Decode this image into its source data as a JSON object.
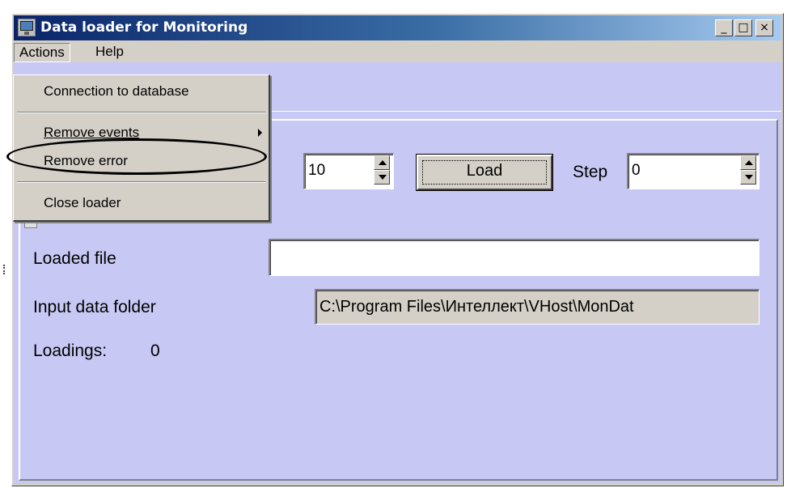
{
  "window": {
    "title": "Data loader for Monitoring",
    "controls": {
      "minimize": "_",
      "maximize": "□",
      "close": "×"
    }
  },
  "menubar": {
    "items": [
      {
        "label": "Actions"
      },
      {
        "label": "Help"
      }
    ]
  },
  "actions_menu": {
    "items": [
      {
        "label": "Connection to database"
      },
      {
        "label": "Remove events",
        "has_submenu": true
      },
      {
        "label": "Remove error",
        "highlighted": true
      },
      {
        "label": "Close loader"
      }
    ]
  },
  "form": {
    "count_value": "10",
    "load_button": "Load",
    "step_label": "Step",
    "step_value": "0",
    "loaded_file_label": "Loaded file",
    "loaded_file_value": "",
    "input_folder_label": "Input data folder",
    "input_folder_value": "C:\\Program Files\\Интеллект\\VHost\\MonDat",
    "loadings_label": "Loadings:",
    "loadings_value": "0"
  },
  "colors": {
    "client_background": "#c8c8f4",
    "titlebar_start": "#0a246a",
    "titlebar_end": "#a6caf0",
    "annotation_ellipse": "#000000"
  },
  "icons": {
    "app": "monitor-icon",
    "spin_up": "triangle-up-icon",
    "spin_down": "triangle-down-icon",
    "submenu": "chevron-right-icon"
  }
}
